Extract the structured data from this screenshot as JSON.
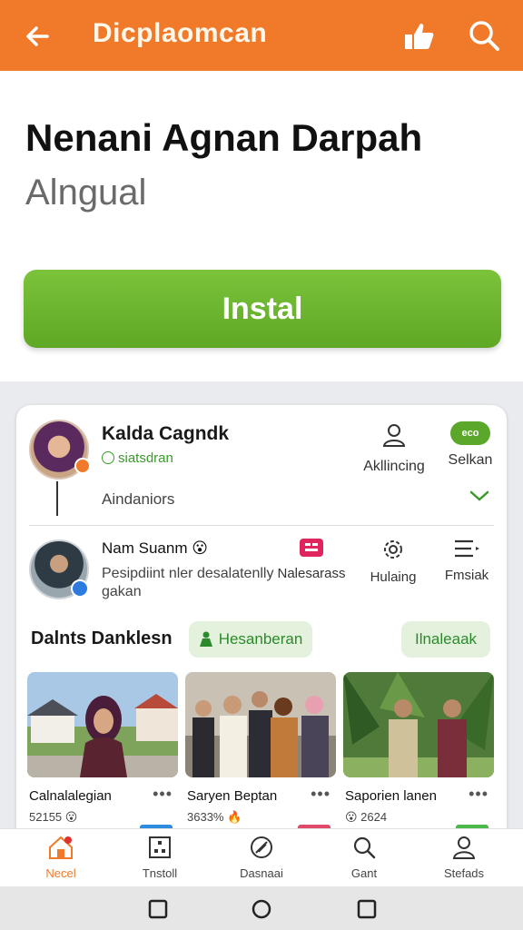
{
  "header": {
    "title": "Dicplaomcan",
    "bg_color": "#f07a2a"
  },
  "app": {
    "name": "Nenani Agnan Darpah",
    "subtitle": "Alngual",
    "install_label": "Instal",
    "install_color": "#6ab52d"
  },
  "profile": {
    "name": "Kalda Cagndk",
    "status": "siatsdran",
    "role": "Aindaniors",
    "action1_label": "Akllincing",
    "action2_pill": "eco",
    "action2_label": "Selkan"
  },
  "post": {
    "name": "Nam Suanm",
    "emoji": "😮",
    "desc": "Pesipdiint nler desalatenlly gakan",
    "tools": [
      "Nalesarass",
      "Hulaing",
      "Fmsiak"
    ]
  },
  "section": {
    "title": "Dalnts Danklesn",
    "chip1": "Hesanberan",
    "chip2": "Ilnaleaak"
  },
  "cards": [
    {
      "caption": "Calnalalegian",
      "stat": "52155 😮",
      "tag_color": "#2d8be0"
    },
    {
      "caption": "Saryen Beptan",
      "stat": "3633% 🔥",
      "tag_color": "#e04a6a"
    },
    {
      "caption": "Saporien lanen",
      "stat": "😮 2624",
      "tag_color": "#4ab84a"
    }
  ],
  "bottom_nav": [
    "Necel",
    "Tnstoll",
    "Dasnaai",
    "Gant",
    "Stefads"
  ]
}
